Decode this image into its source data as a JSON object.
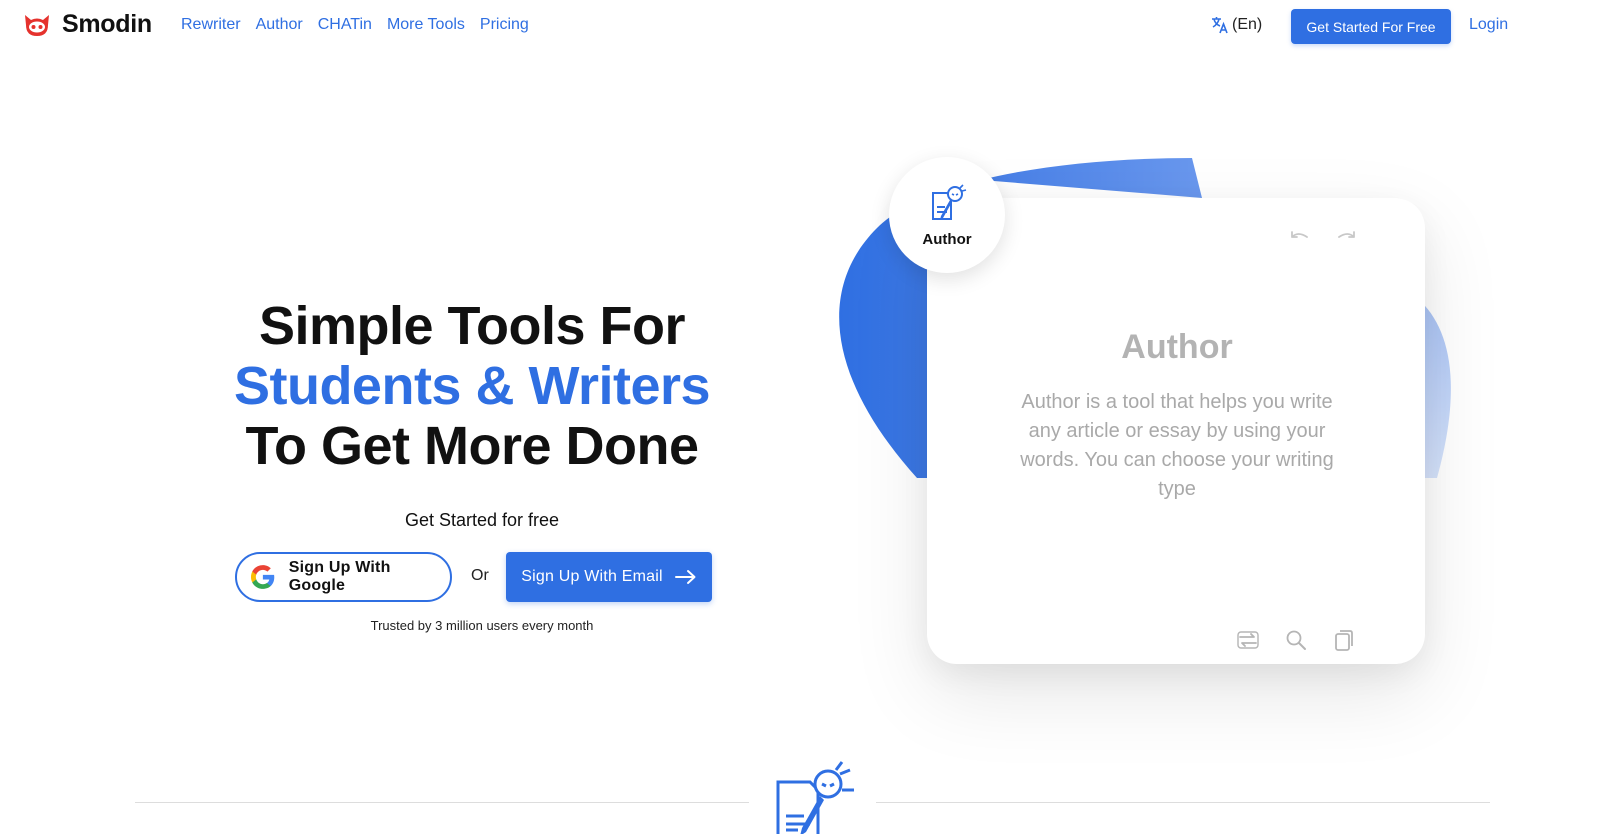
{
  "brand": {
    "name": "Smodin",
    "logo_icon": "smodin-logo-icon"
  },
  "nav": {
    "links": [
      "Rewriter",
      "Author",
      "CHATin",
      "More Tools",
      "Pricing"
    ],
    "language": {
      "icon": "translate-icon",
      "label": "(En)"
    },
    "cta_label": "Get Started For Free",
    "login_label": "Login"
  },
  "hero": {
    "title_line1": "Simple Tools For",
    "title_line2": "Students & Writers",
    "title_line3": "To Get More Done",
    "subtitle": "Get Started for free",
    "google_button_label": "Sign Up With Google",
    "or_label": "Or",
    "email_button_label": "Sign Up With Email",
    "trusted_text": "Trusted by 3 million users every month"
  },
  "illustration": {
    "badge_label": "Author",
    "badge_icon": "author-robot-icon",
    "card_title": "Author",
    "card_description": "Author is a tool that helps you write any article or essay by using your words. You can choose your writing type",
    "card_tools": [
      "undo-icon",
      "redo-icon",
      "rewrite-icon",
      "search-icon",
      "copy-icon"
    ]
  },
  "colors": {
    "accent": "#2f6fe2",
    "text": "#111111",
    "muted": "#a9a9a9"
  }
}
